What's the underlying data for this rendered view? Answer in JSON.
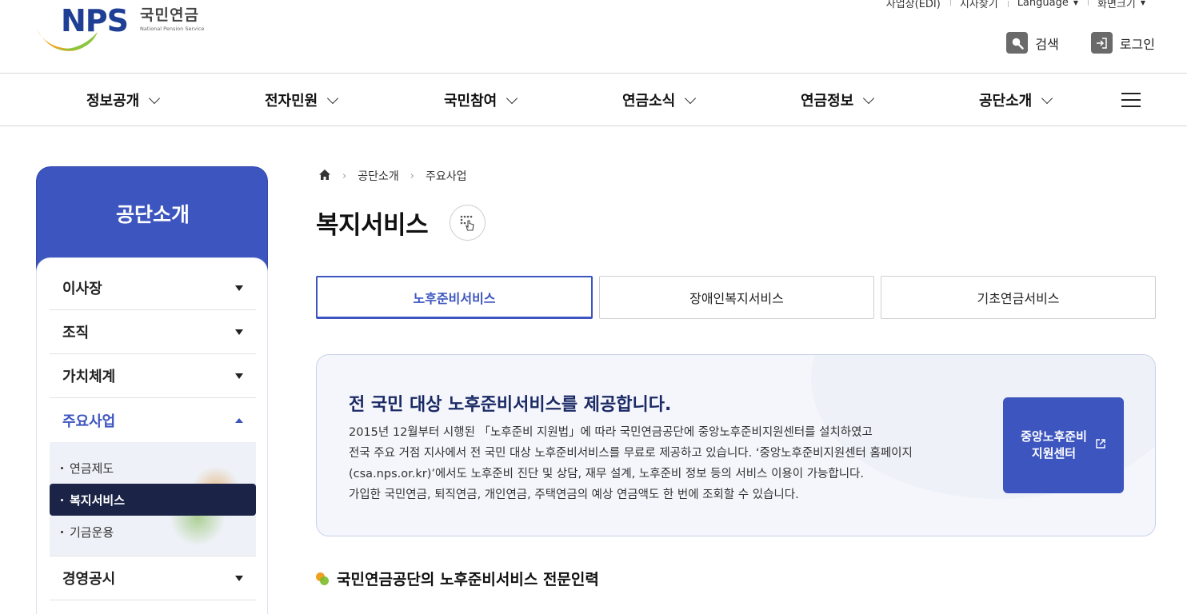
{
  "logo": {
    "mark": "NPS",
    "name_ko": "국민연금",
    "name_en": "National Pension Service"
  },
  "utility": [
    {
      "label": "사업장(EDI)",
      "has_caret": false
    },
    {
      "label": "지사찾기",
      "has_caret": false
    },
    {
      "label": "Language",
      "has_caret": true
    },
    {
      "label": "화면크기",
      "has_caret": true
    }
  ],
  "actions": {
    "search": "검색",
    "login": "로그인"
  },
  "gnb": [
    "정보공개",
    "전자민원",
    "국민참여",
    "연금소식",
    "연금정보",
    "공단소개"
  ],
  "side": {
    "title": "공단소개",
    "menu": [
      "이사장",
      "조직",
      "가치체계",
      "주요사업",
      "경영공시"
    ],
    "submenu": [
      "연금제도",
      "복지서비스",
      "기금운용"
    ]
  },
  "breadcrumb": [
    "공단소개",
    "주요사업"
  ],
  "page_title": "복지서비스",
  "tabs": [
    "노후준비서비스",
    "장애인복지서비스",
    "기초연금서비스"
  ],
  "intro": {
    "heading": "전 국민 대상 노후준비서비스를 제공합니다.",
    "lines": [
      "2015년 12월부터 시행된 「노후준비 지원법」에 따라 국민연금공단에 중앙노후준비지원센터를 설치하였고",
      "전국 주요 거점 지사에서 전 국민 대상 노후준비서비스를 무료로 제공하고 있습니다. ‘중앙노후준비지원센터 홈페이지",
      "(csa.nps.or.kr)’에서도 노후준비 진단 및 상담, 재무 설계, 노후준비 정보 등의 서비스 이용이 가능합니다.",
      "가입한 국민연금, 퇴직연금, 개인연금, 주택연금의 예상 연금액도 한 번에 조회할 수 있습니다."
    ],
    "cta_line1": "중앙노후준비",
    "cta_line2": "지원센터"
  },
  "section_title": "국민연금공단의 노후준비서비스 전문인력",
  "colors": {
    "brand_blue": "#3d55bf",
    "navy": "#1b2447",
    "accent_orange": "#f0a020",
    "accent_green": "#7bbb2a"
  }
}
